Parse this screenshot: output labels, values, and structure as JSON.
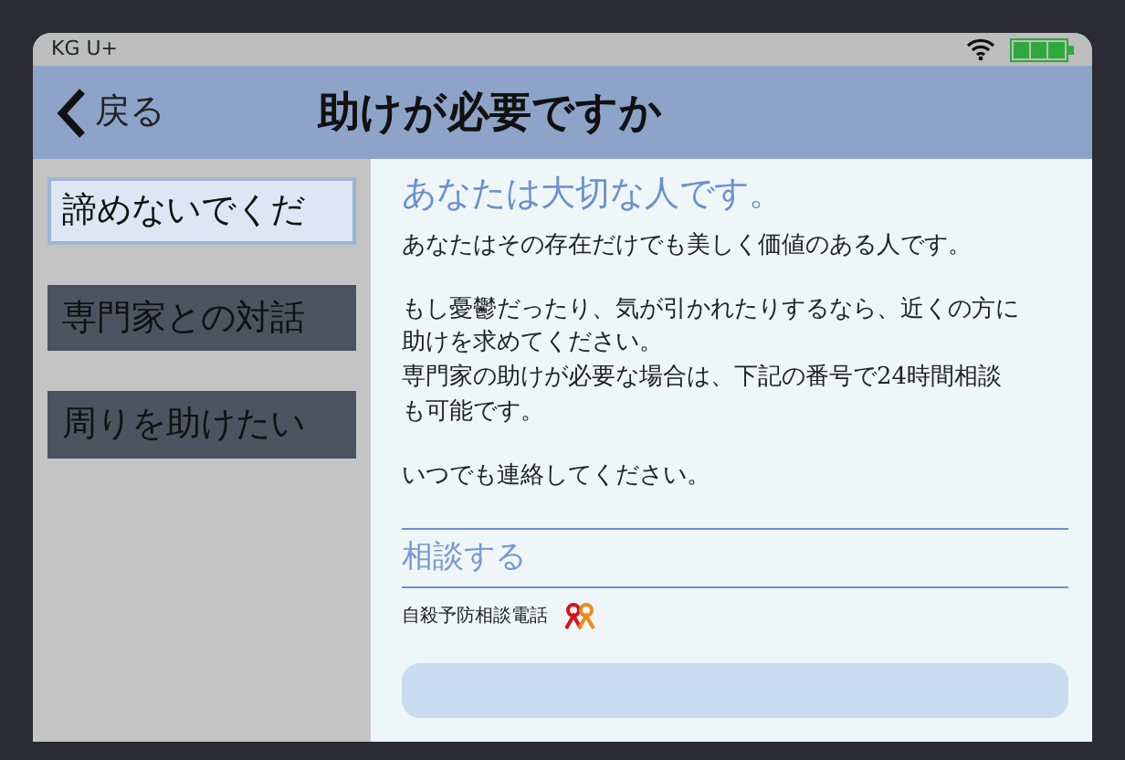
{
  "status_bar": {
    "carrier": "KG U+"
  },
  "nav_bar": {
    "back_label": "戻る",
    "title": "助けが必要ですか"
  },
  "sidebar": {
    "items": [
      {
        "label": "諦めないでくだ",
        "selected": true
      },
      {
        "label": "専門家との対話",
        "selected": false
      },
      {
        "label": "周りを助けたい",
        "selected": false
      }
    ]
  },
  "content": {
    "heading": "あなたは大切な人です。",
    "paragraphs": [
      [
        "あなたはその存在だけでも美しく価値のある人です。"
      ],
      [
        "もし憂鬱だったり、気が引かれたりするなら、近くの方に助けを求めてください。",
        "専門家の助けが必要な場合は、下記の番号で24時間相談も可能です。"
      ],
      [
        "いつでも連絡してください。"
      ]
    ],
    "section_title": "相談する",
    "hotline_label": "自殺予防相談電話"
  }
}
